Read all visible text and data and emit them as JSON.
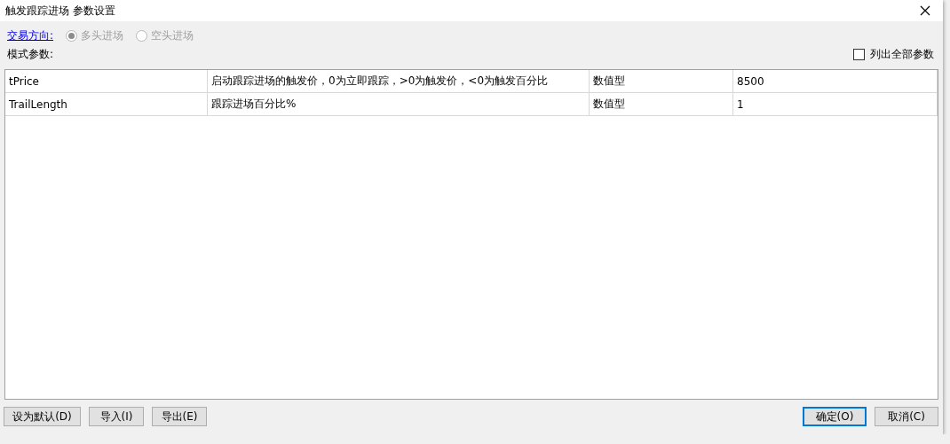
{
  "window": {
    "title": "触发跟踪进场 参数设置"
  },
  "direction": {
    "label": "交易方向:",
    "options": [
      {
        "label": "多头进场",
        "selected": true,
        "disabled": true
      },
      {
        "label": "空头进场",
        "selected": false,
        "disabled": true
      }
    ]
  },
  "mode_label": "模式参数:",
  "show_all": {
    "label": "列出全部参数",
    "checked": false
  },
  "table": {
    "rows": [
      {
        "cells": [
          "tPrice",
          "启动跟踪进场的触发价，0为立即跟踪，>0为触发价，<0为触发百分比",
          "数值型",
          "8500"
        ]
      },
      {
        "cells": [
          "TrailLength",
          "跟踪进场百分比%",
          "数值型",
          "1"
        ]
      }
    ]
  },
  "left_buttons": [
    {
      "label": "设为默认(D)"
    },
    {
      "label": "导入(I)"
    },
    {
      "label": "导出(E)"
    }
  ],
  "right_buttons": [
    {
      "label": "确定(O)",
      "default": true
    },
    {
      "label": "取消(C)",
      "default": false
    }
  ]
}
